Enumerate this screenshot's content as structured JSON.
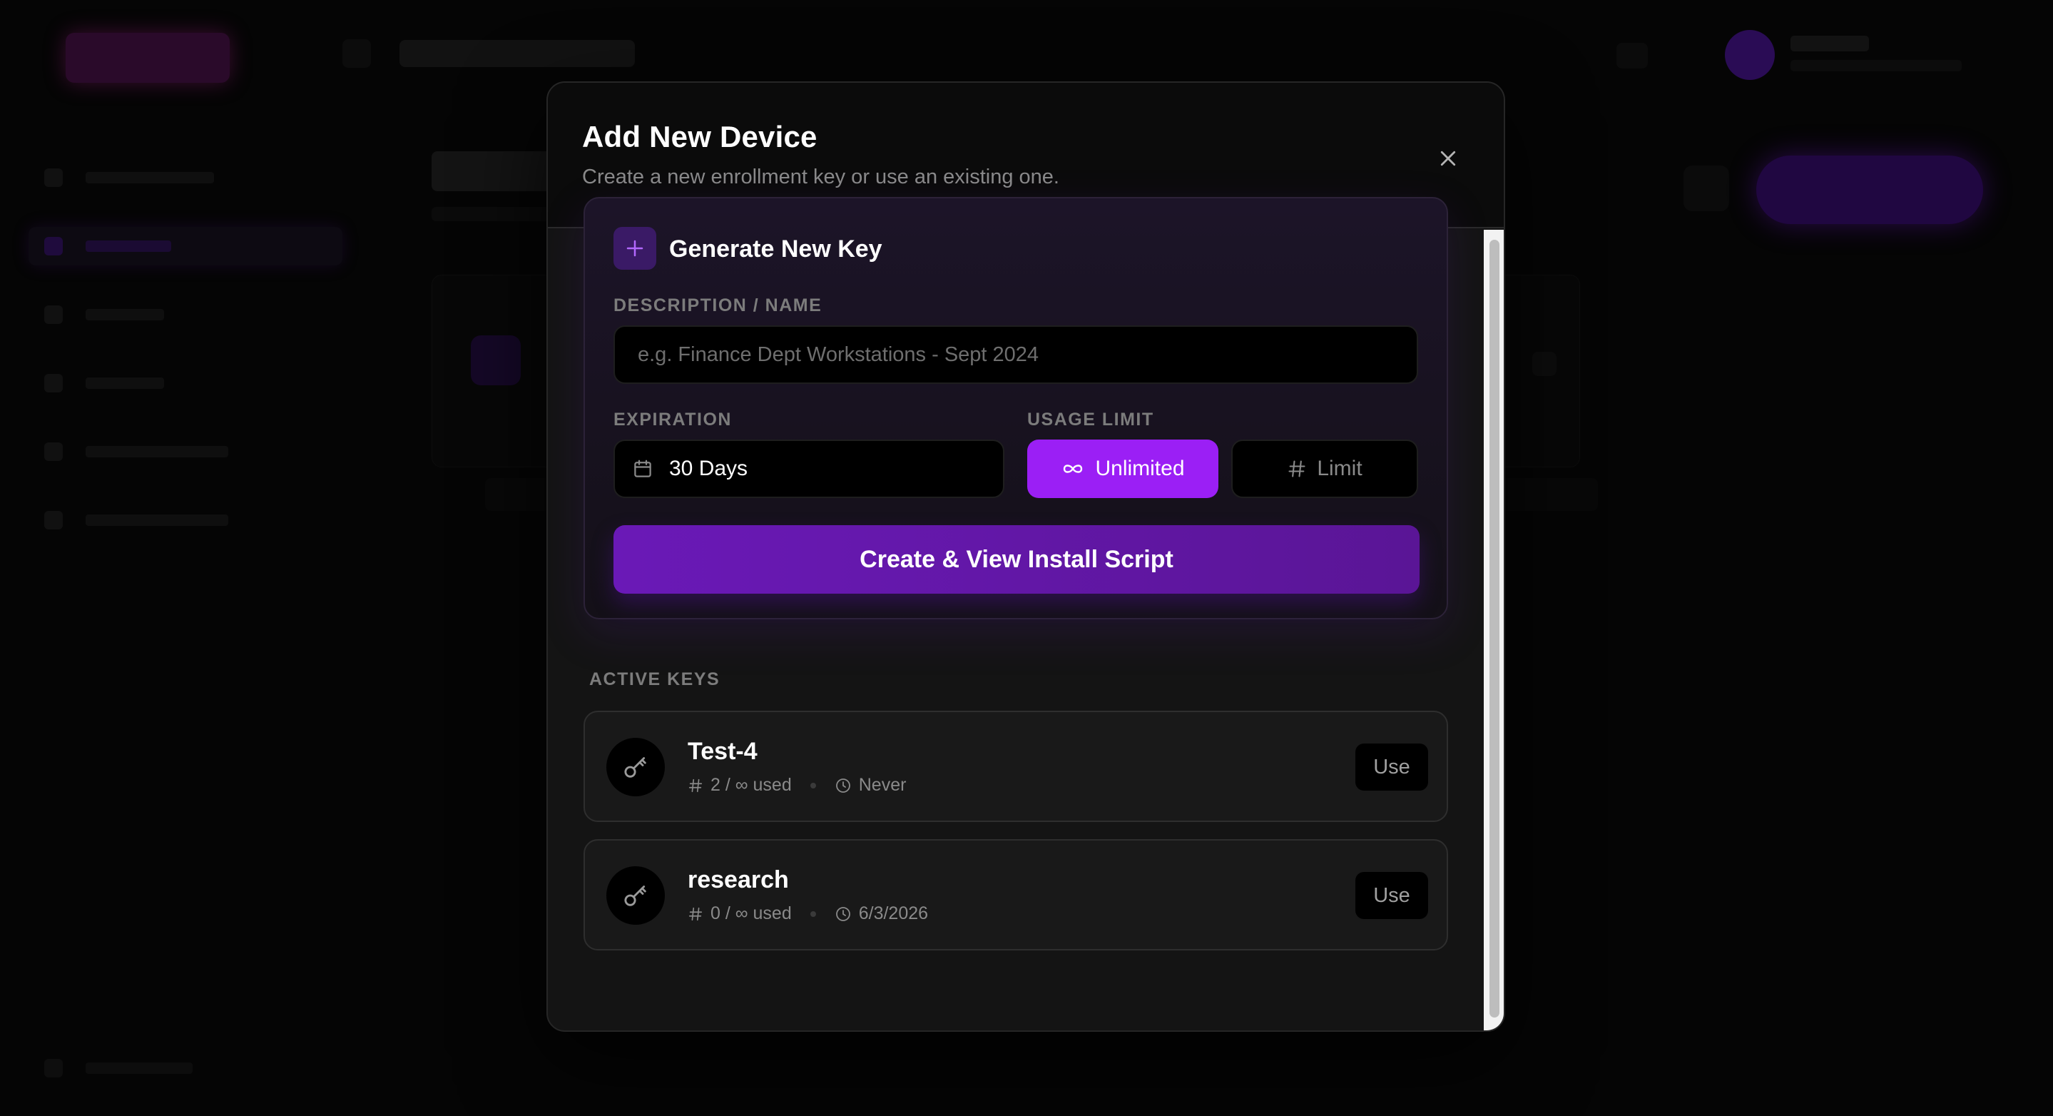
{
  "modal": {
    "title": "Add New Device",
    "subtitle": "Create a new enrollment key or use an existing one.",
    "close_icon": "close-icon"
  },
  "generate": {
    "title": "Generate New Key",
    "icon": "plus-icon",
    "description_label": "DESCRIPTION / NAME",
    "description_placeholder": "e.g. Finance Dept Workstations - Sept 2024",
    "description_value": "",
    "expiration_label": "EXPIRATION",
    "expiration_value": "30 Days",
    "expiration_icon": "calendar-icon",
    "usage_label": "USAGE LIMIT",
    "usage_unlimited_label": "Unlimited",
    "usage_unlimited_icon": "infinity-icon",
    "usage_limit_label": "Limit",
    "usage_limit_icon": "hash-icon",
    "usage_selected": "Unlimited",
    "create_label": "Create & View Install Script"
  },
  "active_keys": {
    "label": "ACTIVE KEYS",
    "items": [
      {
        "name": "Test-4",
        "usage": "2 / ∞ used",
        "expiry": "Never",
        "use_label": "Use"
      },
      {
        "name": "research",
        "usage": "0 / ∞ used",
        "expiry": "6/3/2026",
        "use_label": "Use"
      }
    ]
  },
  "colors": {
    "accent": "#9b1ff5",
    "primary_button": "#6a19b7",
    "modal_bg": "#141414",
    "backdrop": "#000000"
  }
}
